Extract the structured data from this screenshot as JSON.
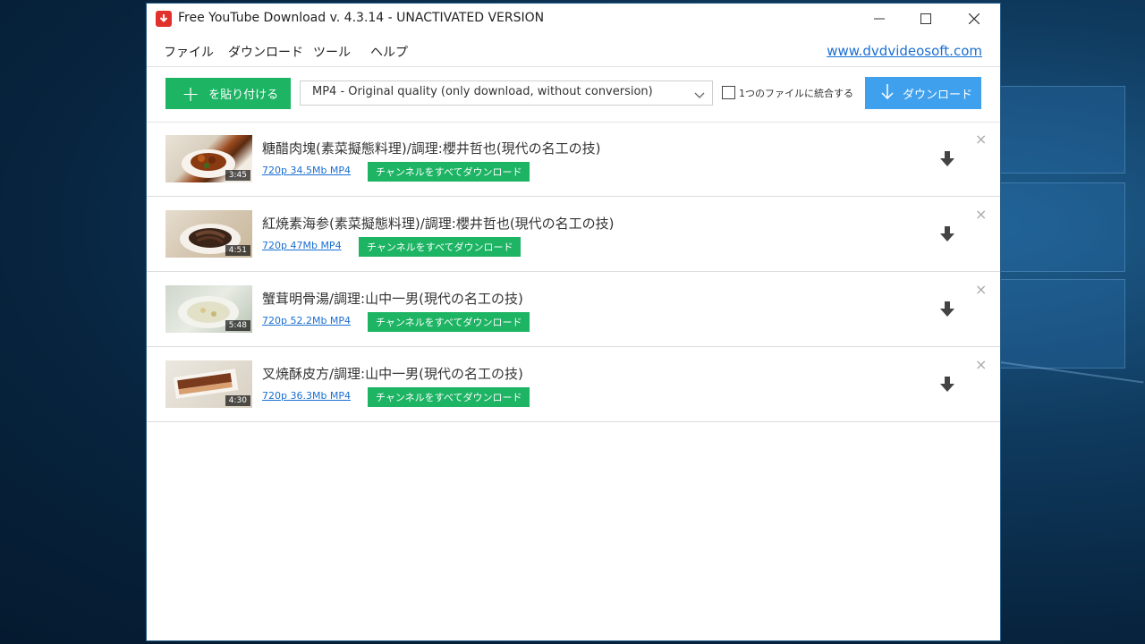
{
  "window": {
    "title": "Free YouTube Download v. 4.3.14 - UNACTIVATED VERSION"
  },
  "menu": {
    "items": [
      "ファイル",
      "ダウンロード",
      "ツール",
      "ヘルプ"
    ],
    "link": "www.dvdvideosoft.com"
  },
  "toolbar": {
    "paste_label": "を貼り付ける",
    "format_value": "MP4 - Original quality (only download, without conversion)",
    "merge_label": "1つのファイルに統合する",
    "download_label": "ダウンロード"
  },
  "videos": [
    {
      "title": "糖醋肉塊(素菜擬態料理)/調理:櫻井哲也(現代の名工の技)",
      "duration": "3:45",
      "link": "720p 34.5Mb MP4",
      "channel_btn": "チャンネルをすべてダウンロード"
    },
    {
      "title": "紅焼素海参(素菜擬態料理)/調理:櫻井哲也(現代の名工の技)",
      "duration": "4:51",
      "link": "720p 47Mb MP4",
      "channel_btn": "チャンネルをすべてダウンロード"
    },
    {
      "title": "蟹茸明骨湯/調理:山中一男(現代の名工の技)",
      "duration": "5:48",
      "link": "720p 52.2Mb MP4",
      "channel_btn": "チャンネルをすべてダウンロード"
    },
    {
      "title": "叉焼酥皮方/調理:山中一男(現代の名工の技)",
      "duration": "4:30",
      "link": "720p 36.3Mb MP4",
      "channel_btn": "チャンネルをすべてダウンロード"
    }
  ],
  "colors": {
    "green": "#1db464",
    "blue": "#3fa0ee",
    "link": "#1a6fd1",
    "brand_red": "#e2302a"
  }
}
